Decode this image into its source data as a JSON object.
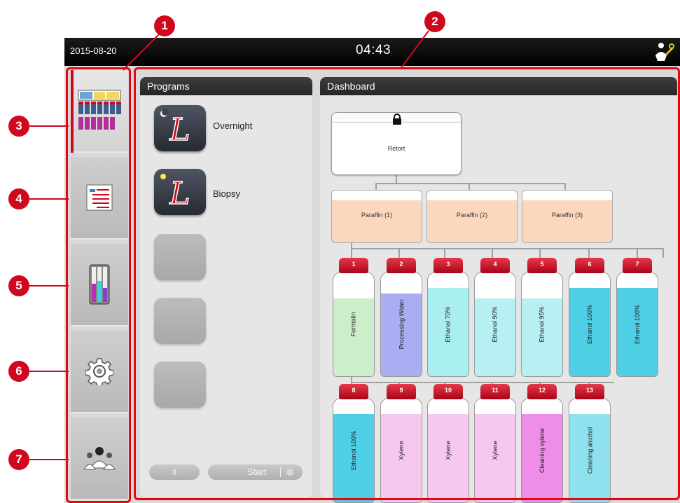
{
  "header": {
    "date": "2015-08-20",
    "time": "04:43",
    "user_icon": "user-with-key-icon"
  },
  "sidebar": {
    "items": [
      {
        "icon": "status-overview-icon",
        "active": true
      },
      {
        "icon": "program-list-icon",
        "active": false
      },
      {
        "icon": "reagents-icon",
        "active": false
      },
      {
        "icon": "settings-gear-icon",
        "active": false
      },
      {
        "icon": "users-icon",
        "active": false
      }
    ]
  },
  "programs": {
    "title": "Programs",
    "items": [
      {
        "label": "Overnight",
        "icon": "program-moon-icon"
      },
      {
        "label": "Biopsy",
        "icon": "program-sun-icon"
      },
      {
        "label": "",
        "icon": "empty-slot"
      },
      {
        "label": "",
        "icon": "empty-slot"
      },
      {
        "label": "",
        "icon": "empty-slot"
      }
    ],
    "pause_label": "II",
    "start_label": "Start"
  },
  "dashboard": {
    "title": "Dashboard",
    "retort": {
      "label": "Retort",
      "icon": "lock-icon"
    },
    "paraffin_baths": [
      {
        "label": "Paraffin (1)"
      },
      {
        "label": "Paraffin (2)"
      },
      {
        "label": "Paraffin (3)"
      }
    ],
    "bottles_row1": [
      {
        "num": "1",
        "name": "Formalin",
        "color": "#cdeecb",
        "fill": 0.75
      },
      {
        "num": "2",
        "name": "Processing Water",
        "color": "#a9aef2",
        "fill": 0.8
      },
      {
        "num": "3",
        "name": "Ethanol 70%",
        "color": "#a9eef1",
        "fill": 0.85
      },
      {
        "num": "4",
        "name": "Ethanol 90%",
        "color": "#b6f0f2",
        "fill": 0.75
      },
      {
        "num": "5",
        "name": "Ethanol 95%",
        "color": "#b6f0f2",
        "fill": 0.75
      },
      {
        "num": "6",
        "name": "Ethanol 100%",
        "color": "#4fcfe6",
        "fill": 0.85
      },
      {
        "num": "7",
        "name": "Ethanol 100%",
        "color": "#4fcfe6",
        "fill": 0.85
      }
    ],
    "bottles_row2": [
      {
        "num": "8",
        "name": "Ethanol 100%",
        "color": "#4fcfe6",
        "fill": 0.85
      },
      {
        "num": "9",
        "name": "Xylene",
        "color": "#f6c8f0",
        "fill": 0.85
      },
      {
        "num": "10",
        "name": "Xylene",
        "color": "#f6c8f0",
        "fill": 0.85
      },
      {
        "num": "11",
        "name": "Xylene",
        "color": "#f6c8f0",
        "fill": 0.85
      },
      {
        "num": "12",
        "name": "Cleaning xylene",
        "color": "#ee8ee8",
        "fill": 0.85
      },
      {
        "num": "13",
        "name": "Cleaning alcohol",
        "color": "#8fe1ef",
        "fill": 0.85
      }
    ]
  },
  "callouts": [
    "1",
    "2",
    "3",
    "4",
    "5",
    "6",
    "7"
  ],
  "colors": {
    "brand_red": "#d1071e",
    "bar_black": "#000000",
    "panel_grey": "#e6e6e6"
  }
}
